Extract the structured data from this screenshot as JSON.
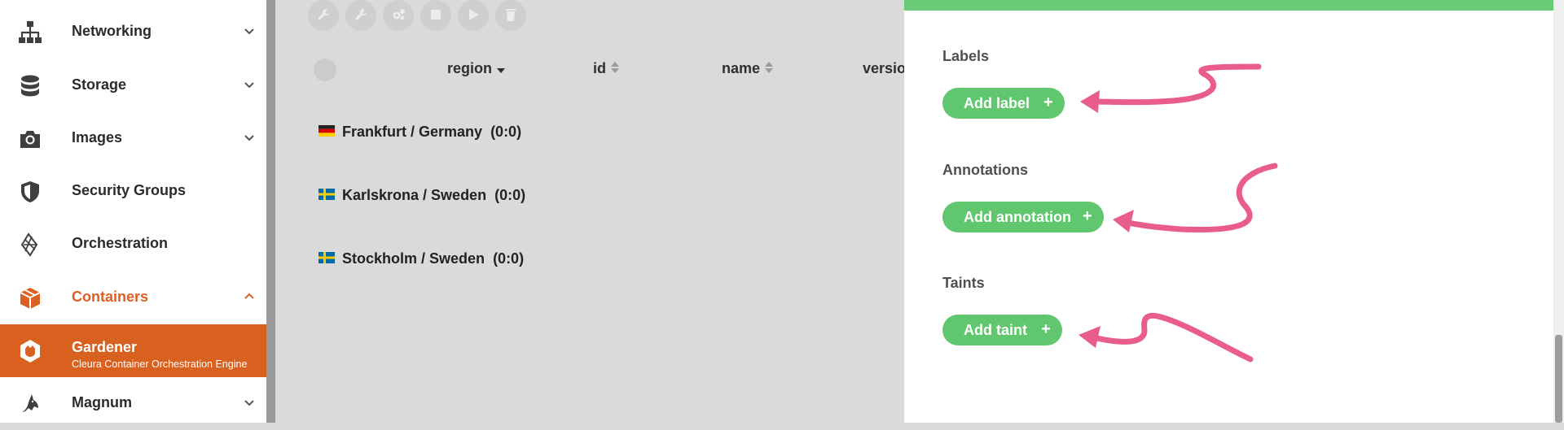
{
  "sidebar": {
    "items": [
      {
        "label": "Networking",
        "icon": "network-icon"
      },
      {
        "label": "Storage",
        "icon": "database-icon"
      },
      {
        "label": "Images",
        "icon": "camera-icon"
      },
      {
        "label": "Security Groups",
        "icon": "shield-icon"
      },
      {
        "label": "Orchestration",
        "icon": "orchestration-icon"
      },
      {
        "label": "Containers",
        "icon": "cube-icon"
      },
      {
        "label": "Magnum",
        "icon": "shark-icon"
      }
    ],
    "active": {
      "title": "Gardener",
      "description": "Cleura Container Orchestration Engine",
      "icon": "gardener-icon"
    }
  },
  "toolbar": {
    "buttons": [
      "wrench-icon",
      "wrench-icon",
      "gears-icon",
      "stop-icon",
      "play-icon",
      "trash-icon"
    ]
  },
  "table": {
    "columns": [
      "region",
      "id",
      "name",
      "versio"
    ],
    "rows": [
      {
        "region": "Frankfurt / Germany",
        "count": "(0:0)",
        "flag": "de"
      },
      {
        "region": "Karlskrona / Sweden",
        "count": "(0:0)",
        "flag": "se"
      },
      {
        "region": "Stockholm / Sweden",
        "count": "(0:0)",
        "flag": "se"
      }
    ]
  },
  "panel": {
    "sections": [
      {
        "title": "Labels",
        "button": "Add label"
      },
      {
        "title": "Annotations",
        "button": "Add annotation"
      },
      {
        "title": "Taints",
        "button": "Add taint"
      }
    ]
  },
  "colors": {
    "accent_orange": "#d9611f",
    "accent_green": "#60c76e",
    "annotation_arrow": "#e85c8e"
  }
}
